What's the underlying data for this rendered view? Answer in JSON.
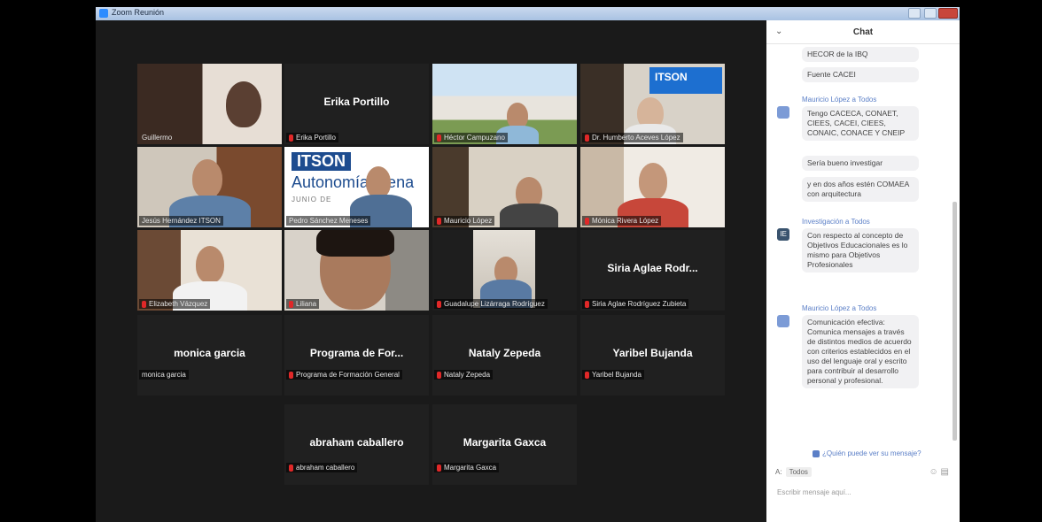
{
  "window": {
    "title": "Zoom Reunión"
  },
  "colors": {
    "accent": "#2d8cff",
    "active_speaker": "#b8d432",
    "muted": "#e02828",
    "chat_link": "#5b7fc7"
  },
  "tiles": {
    "t1": {
      "name": "Guillermo"
    },
    "t2": {
      "display": "Erika Portillo",
      "name": "Erika Portillo"
    },
    "t3": {
      "name": "Héctor Campuzano"
    },
    "t4": {
      "name": "Dr. Humberto Aceves López",
      "banner": "ITSON"
    },
    "t5": {
      "name": "Jesús Hernández ITSON"
    },
    "t6": {
      "name": "Pedro Sánchez Meneses",
      "banner1": "ITSON",
      "banner2": "Autonomía Plena",
      "banner3": "JUNIO DE"
    },
    "t7": {
      "name": "Mauricio López"
    },
    "t8": {
      "name": "Mónica Rivera López"
    },
    "t9": {
      "name": "Elizabeth Vázquez"
    },
    "t10": {
      "name": "Liliana"
    },
    "t11": {
      "name": "Guadalupe Lizárraga Rodríguez"
    },
    "t12": {
      "display": "Siria Aglae Rodr...",
      "name": "Siria Aglae Rodríguez Zubieta"
    },
    "t13": {
      "display": "monica garcia",
      "name": "monica garcia"
    },
    "t14": {
      "display": "Programa de For...",
      "name": "Programa de Formación General"
    },
    "t15": {
      "display": "Nataly Zepeda",
      "name": "Nataly Zepeda"
    },
    "t16": {
      "display": "Yaribel Bujanda",
      "name": "Yaribel Bujanda"
    },
    "t17": {
      "display": "abraham caballero",
      "name": "abraham caballero"
    },
    "t18": {
      "display": "Margarita Gaxca",
      "name": "Margarita Gaxca"
    }
  },
  "chat": {
    "title": "Chat",
    "messages": [
      {
        "text": "HECOR de la IBQ"
      },
      {
        "text": "Fuente CACEI"
      },
      {
        "sender": "Mauricio López a Todos",
        "text": "Tengo CACECA, CONAET, CIEES, CACEI, CIEES, CONAIC, CONACE Y CNEIP"
      },
      {
        "text": "Sería bueno investigar"
      },
      {
        "text": "y en dos años estén COMAEA con arquitectura"
      },
      {
        "sender": "Investigación a Todos",
        "avatar": "IE",
        "text": "Con respecto al concepto de Objetivos Educacionales es lo mismo para Objetivos Profesionales"
      },
      {
        "sender": "Mauricio López a Todos",
        "text": "Comunicación efectiva: Comunica mensajes a través de distintos medios de acuerdo con criterios establecidos en el uso del lenguaje oral y escrito para contribuir al desarrollo personal y profesional."
      }
    ],
    "who_link": "¿Quién puede ver su mensaje?",
    "to_label": "A:",
    "to_value": "Todos",
    "input_placeholder": "Escribir mensaje aquí..."
  }
}
